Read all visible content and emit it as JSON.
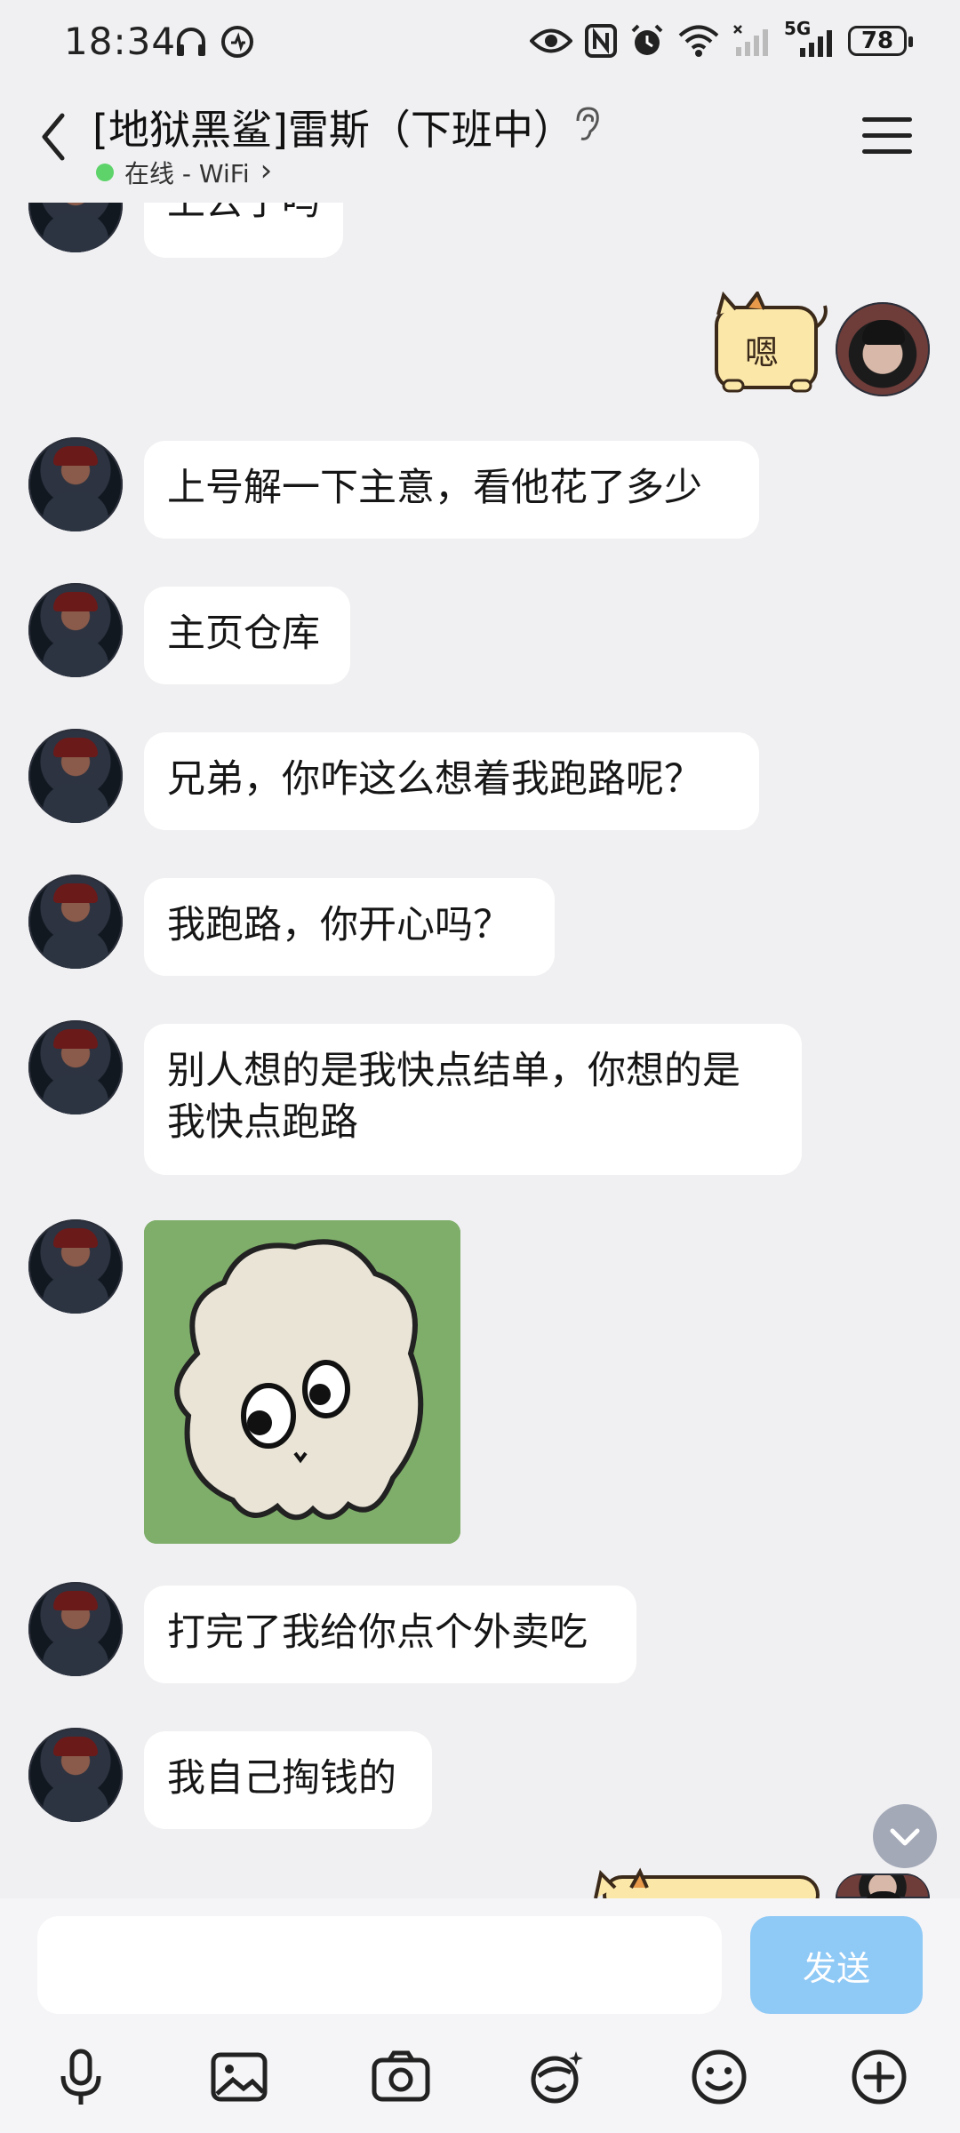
{
  "status_bar": {
    "time": "18:34",
    "network": "5G",
    "battery": "78"
  },
  "header": {
    "title": "[地狱黑鲨]雷斯（下班中）",
    "status": "在线 - WiFi",
    "status_chevron": "›"
  },
  "messages": {
    "m0": "上去了吗",
    "sticker_me_text": "嗯",
    "m1": "上号解一下主意，看他花了多少",
    "m2": "主页仓库",
    "m3": "兄弟，你咋这么想着我跑路呢？",
    "m4": "我跑路，你开心吗？",
    "m5_line1": "别人想的是我快点结单，你想的是",
    "m5_line2": "我快点跑路",
    "m6": "打完了我给你点个外卖吃",
    "m7": "我自己掏钱的"
  },
  "input": {
    "placeholder": "",
    "send_label": "发送"
  },
  "colors": {
    "background": "#f0f0f2",
    "bubble": "#ffffff",
    "send_button": "#8fc9f6",
    "online_dot": "#5dd36a"
  }
}
